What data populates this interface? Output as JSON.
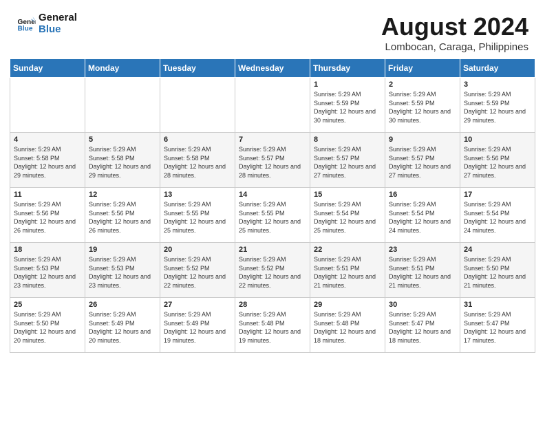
{
  "header": {
    "logo_line1": "General",
    "logo_line2": "Blue",
    "title": "August 2024",
    "subtitle": "Lombocan, Caraga, Philippines"
  },
  "weekdays": [
    "Sunday",
    "Monday",
    "Tuesday",
    "Wednesday",
    "Thursday",
    "Friday",
    "Saturday"
  ],
  "weeks": [
    [
      {
        "day": "",
        "sunrise": "",
        "sunset": "",
        "daylight": ""
      },
      {
        "day": "",
        "sunrise": "",
        "sunset": "",
        "daylight": ""
      },
      {
        "day": "",
        "sunrise": "",
        "sunset": "",
        "daylight": ""
      },
      {
        "day": "",
        "sunrise": "",
        "sunset": "",
        "daylight": ""
      },
      {
        "day": "1",
        "sunrise": "Sunrise: 5:29 AM",
        "sunset": "Sunset: 5:59 PM",
        "daylight": "Daylight: 12 hours and 30 minutes."
      },
      {
        "day": "2",
        "sunrise": "Sunrise: 5:29 AM",
        "sunset": "Sunset: 5:59 PM",
        "daylight": "Daylight: 12 hours and 30 minutes."
      },
      {
        "day": "3",
        "sunrise": "Sunrise: 5:29 AM",
        "sunset": "Sunset: 5:59 PM",
        "daylight": "Daylight: 12 hours and 29 minutes."
      }
    ],
    [
      {
        "day": "4",
        "sunrise": "Sunrise: 5:29 AM",
        "sunset": "Sunset: 5:58 PM",
        "daylight": "Daylight: 12 hours and 29 minutes."
      },
      {
        "day": "5",
        "sunrise": "Sunrise: 5:29 AM",
        "sunset": "Sunset: 5:58 PM",
        "daylight": "Daylight: 12 hours and 29 minutes."
      },
      {
        "day": "6",
        "sunrise": "Sunrise: 5:29 AM",
        "sunset": "Sunset: 5:58 PM",
        "daylight": "Daylight: 12 hours and 28 minutes."
      },
      {
        "day": "7",
        "sunrise": "Sunrise: 5:29 AM",
        "sunset": "Sunset: 5:57 PM",
        "daylight": "Daylight: 12 hours and 28 minutes."
      },
      {
        "day": "8",
        "sunrise": "Sunrise: 5:29 AM",
        "sunset": "Sunset: 5:57 PM",
        "daylight": "Daylight: 12 hours and 27 minutes."
      },
      {
        "day": "9",
        "sunrise": "Sunrise: 5:29 AM",
        "sunset": "Sunset: 5:57 PM",
        "daylight": "Daylight: 12 hours and 27 minutes."
      },
      {
        "day": "10",
        "sunrise": "Sunrise: 5:29 AM",
        "sunset": "Sunset: 5:56 PM",
        "daylight": "Daylight: 12 hours and 27 minutes."
      }
    ],
    [
      {
        "day": "11",
        "sunrise": "Sunrise: 5:29 AM",
        "sunset": "Sunset: 5:56 PM",
        "daylight": "Daylight: 12 hours and 26 minutes."
      },
      {
        "day": "12",
        "sunrise": "Sunrise: 5:29 AM",
        "sunset": "Sunset: 5:56 PM",
        "daylight": "Daylight: 12 hours and 26 minutes."
      },
      {
        "day": "13",
        "sunrise": "Sunrise: 5:29 AM",
        "sunset": "Sunset: 5:55 PM",
        "daylight": "Daylight: 12 hours and 25 minutes."
      },
      {
        "day": "14",
        "sunrise": "Sunrise: 5:29 AM",
        "sunset": "Sunset: 5:55 PM",
        "daylight": "Daylight: 12 hours and 25 minutes."
      },
      {
        "day": "15",
        "sunrise": "Sunrise: 5:29 AM",
        "sunset": "Sunset: 5:54 PM",
        "daylight": "Daylight: 12 hours and 25 minutes."
      },
      {
        "day": "16",
        "sunrise": "Sunrise: 5:29 AM",
        "sunset": "Sunset: 5:54 PM",
        "daylight": "Daylight: 12 hours and 24 minutes."
      },
      {
        "day": "17",
        "sunrise": "Sunrise: 5:29 AM",
        "sunset": "Sunset: 5:54 PM",
        "daylight": "Daylight: 12 hours and 24 minutes."
      }
    ],
    [
      {
        "day": "18",
        "sunrise": "Sunrise: 5:29 AM",
        "sunset": "Sunset: 5:53 PM",
        "daylight": "Daylight: 12 hours and 23 minutes."
      },
      {
        "day": "19",
        "sunrise": "Sunrise: 5:29 AM",
        "sunset": "Sunset: 5:53 PM",
        "daylight": "Daylight: 12 hours and 23 minutes."
      },
      {
        "day": "20",
        "sunrise": "Sunrise: 5:29 AM",
        "sunset": "Sunset: 5:52 PM",
        "daylight": "Daylight: 12 hours and 22 minutes."
      },
      {
        "day": "21",
        "sunrise": "Sunrise: 5:29 AM",
        "sunset": "Sunset: 5:52 PM",
        "daylight": "Daylight: 12 hours and 22 minutes."
      },
      {
        "day": "22",
        "sunrise": "Sunrise: 5:29 AM",
        "sunset": "Sunset: 5:51 PM",
        "daylight": "Daylight: 12 hours and 21 minutes."
      },
      {
        "day": "23",
        "sunrise": "Sunrise: 5:29 AM",
        "sunset": "Sunset: 5:51 PM",
        "daylight": "Daylight: 12 hours and 21 minutes."
      },
      {
        "day": "24",
        "sunrise": "Sunrise: 5:29 AM",
        "sunset": "Sunset: 5:50 PM",
        "daylight": "Daylight: 12 hours and 21 minutes."
      }
    ],
    [
      {
        "day": "25",
        "sunrise": "Sunrise: 5:29 AM",
        "sunset": "Sunset: 5:50 PM",
        "daylight": "Daylight: 12 hours and 20 minutes."
      },
      {
        "day": "26",
        "sunrise": "Sunrise: 5:29 AM",
        "sunset": "Sunset: 5:49 PM",
        "daylight": "Daylight: 12 hours and 20 minutes."
      },
      {
        "day": "27",
        "sunrise": "Sunrise: 5:29 AM",
        "sunset": "Sunset: 5:49 PM",
        "daylight": "Daylight: 12 hours and 19 minutes."
      },
      {
        "day": "28",
        "sunrise": "Sunrise: 5:29 AM",
        "sunset": "Sunset: 5:48 PM",
        "daylight": "Daylight: 12 hours and 19 minutes."
      },
      {
        "day": "29",
        "sunrise": "Sunrise: 5:29 AM",
        "sunset": "Sunset: 5:48 PM",
        "daylight": "Daylight: 12 hours and 18 minutes."
      },
      {
        "day": "30",
        "sunrise": "Sunrise: 5:29 AM",
        "sunset": "Sunset: 5:47 PM",
        "daylight": "Daylight: 12 hours and 18 minutes."
      },
      {
        "day": "31",
        "sunrise": "Sunrise: 5:29 AM",
        "sunset": "Sunset: 5:47 PM",
        "daylight": "Daylight: 12 hours and 17 minutes."
      }
    ]
  ]
}
